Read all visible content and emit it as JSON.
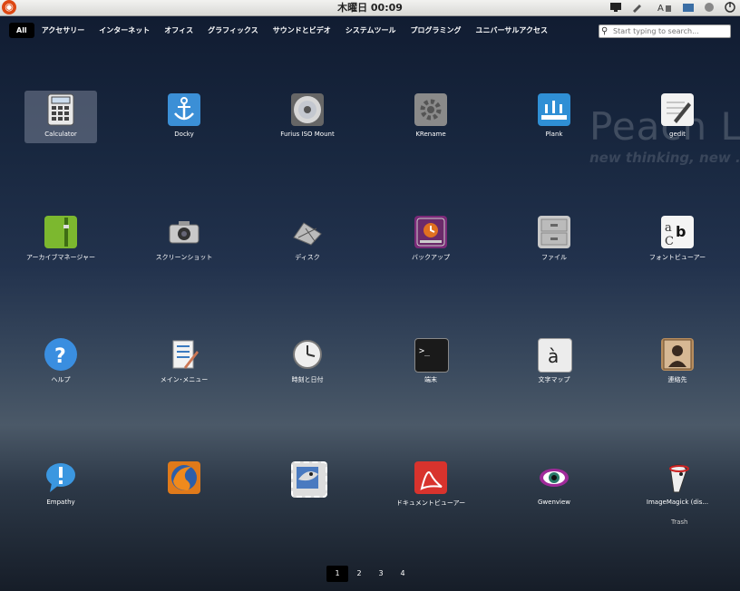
{
  "topbar": {
    "clock": "木曜日 00:09",
    "logo_icon": "ubuntu-logo-icon",
    "tray_icons": [
      "monitor-icon",
      "pen-icon",
      "keyboard-input-icon",
      "window-icon",
      "network-icon",
      "power-icon"
    ]
  },
  "categories": [
    "All",
    "アクセサリー",
    "インターネット",
    "オフィス",
    "グラフィックス",
    "サウンドとビデオ",
    "システムツール",
    "プログラミング",
    "ユニバーサルアクセス"
  ],
  "search": {
    "placeholder": "Start typing to search..."
  },
  "watermark": {
    "title": "Peach Linux",
    "subtitle": "new thinking, new ..."
  },
  "apps": [
    {
      "label": "Calculator",
      "icon": "calculator-icon"
    },
    {
      "label": "Docky",
      "icon": "anchor-icon"
    },
    {
      "label": "Furius ISO Mount",
      "icon": "disc-icon"
    },
    {
      "label": "KRename",
      "icon": "gear-icon"
    },
    {
      "label": "Plank",
      "icon": "plank-icon"
    },
    {
      "label": "gedit",
      "icon": "text-editor-icon"
    },
    {
      "label": "アーカイブマネージャー",
      "icon": "archive-icon"
    },
    {
      "label": "スクリーンショット",
      "icon": "camera-icon"
    },
    {
      "label": "ディスク",
      "icon": "disk-utility-icon"
    },
    {
      "label": "バックアップ",
      "icon": "backup-icon"
    },
    {
      "label": "ファイル",
      "icon": "file-cabinet-icon"
    },
    {
      "label": "フォントビューアー",
      "icon": "font-viewer-icon"
    },
    {
      "label": "ヘルプ",
      "icon": "help-icon"
    },
    {
      "label": "メイン･メニュー",
      "icon": "menu-editor-icon"
    },
    {
      "label": "時刻と日付",
      "icon": "clock-icon"
    },
    {
      "label": "端末",
      "icon": "terminal-icon"
    },
    {
      "label": "文字マップ",
      "icon": "character-map-icon"
    },
    {
      "label": "連絡先",
      "icon": "contacts-icon"
    },
    {
      "label": "Empathy",
      "icon": "chat-bubble-icon"
    },
    {
      "label": "",
      "icon": "firefox-icon"
    },
    {
      "label": "",
      "icon": "thunderbird-icon"
    },
    {
      "label": "ドキュメントビューアー",
      "icon": "document-viewer-icon"
    },
    {
      "label": "Gwenview",
      "icon": "eye-icon"
    },
    {
      "label": "ImageMagick (dis...",
      "icon": "imagemagick-icon"
    }
  ],
  "trash_label": "Trash",
  "pagination": [
    "1",
    "2",
    "3",
    "4"
  ]
}
